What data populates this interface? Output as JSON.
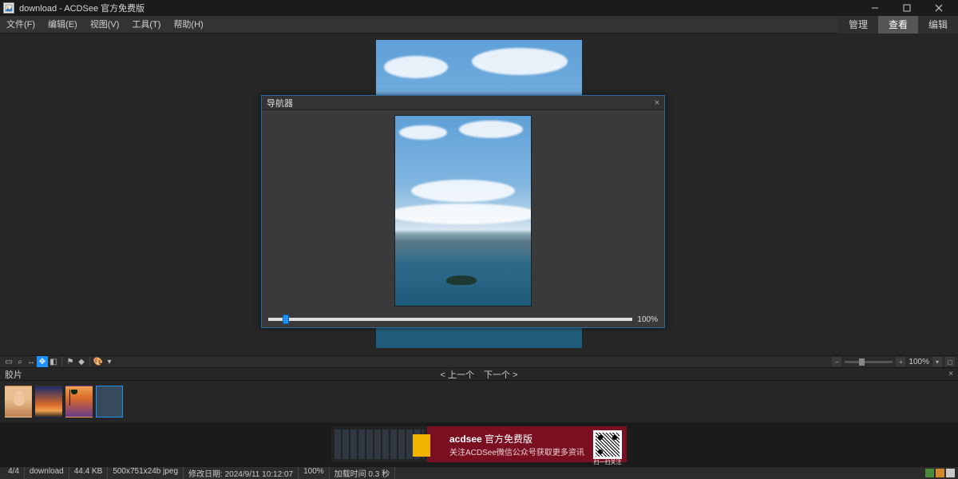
{
  "title": "download - ACDSee 官方免费版",
  "menus": {
    "file": "文件(F)",
    "edit": "编辑(E)",
    "view": "视图(V)",
    "tools": "工具(T)",
    "help": "帮助(H)"
  },
  "mode_tabs": {
    "manage": "管理",
    "view": "查看",
    "edit": "编辑"
  },
  "navigator": {
    "title": "导航器",
    "close": "×",
    "zoom_pct": "100%"
  },
  "zoombar": {
    "pct": "100%"
  },
  "filmstrip": {
    "label": "胶片",
    "prev": "< 上一个",
    "next": "下一个 >",
    "close": "×"
  },
  "ad": {
    "brand": "acdsee",
    "brand_suffix": "官方免费版",
    "sub": "关注ACDSee微信公众号获取更多资讯",
    "qr_cap": "扫一扫关注"
  },
  "status": {
    "idx": "4/4",
    "folder": "download",
    "size": "44.4 KB",
    "dims": "500x751x24b jpeg",
    "mod": "修改日期: 2024/9/11 10:12:07",
    "zoom": "100%",
    "load": "加载时间 0.3 秒"
  }
}
